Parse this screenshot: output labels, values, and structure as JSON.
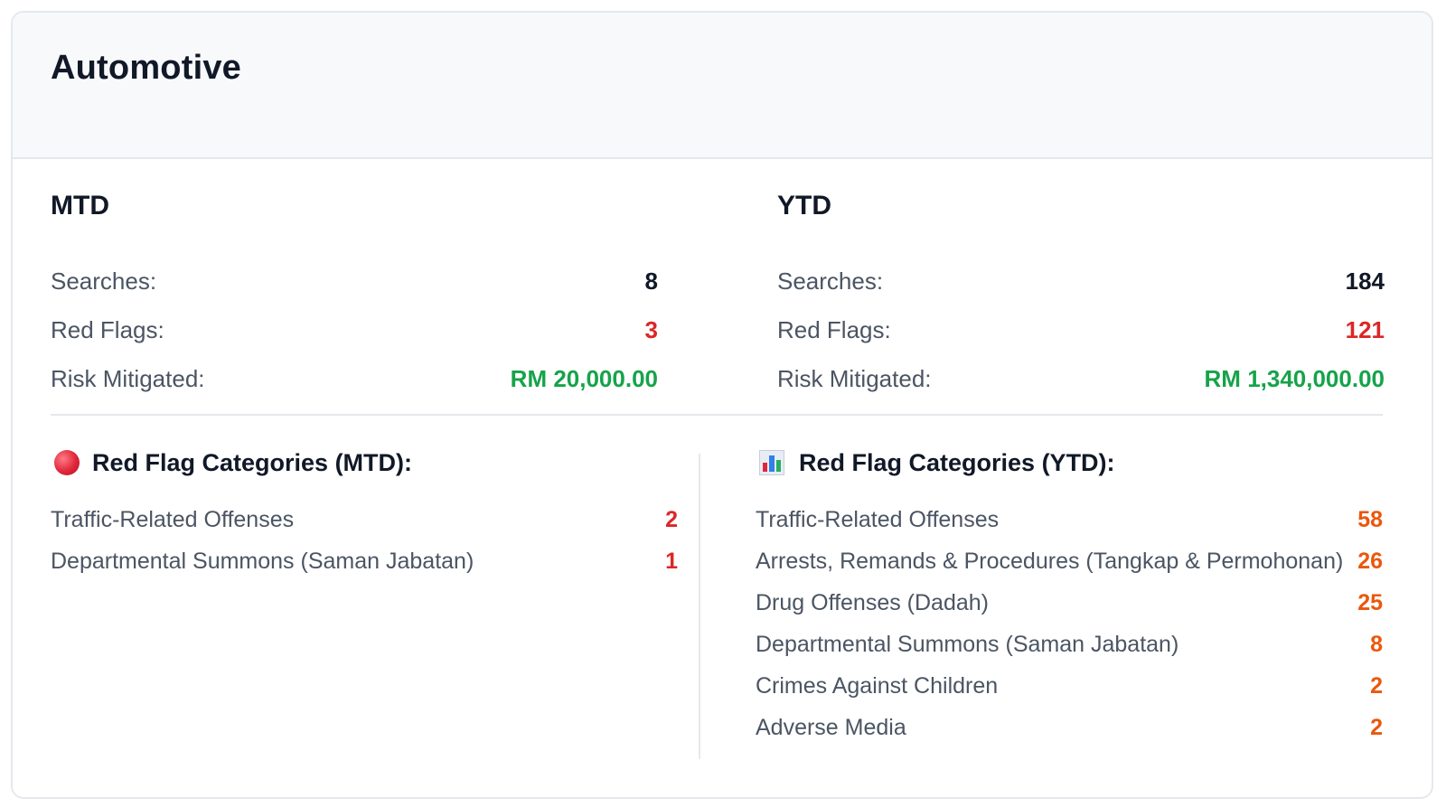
{
  "card": {
    "title": "Automotive"
  },
  "mtd": {
    "title": "MTD",
    "stats": [
      {
        "label": "Searches:",
        "value": "8"
      },
      {
        "label": "Red Flags:",
        "value": "3"
      },
      {
        "label": "Risk Mitigated:",
        "value": "RM 20,000.00"
      }
    ]
  },
  "ytd": {
    "title": "YTD",
    "stats": [
      {
        "label": "Searches:",
        "value": "184"
      },
      {
        "label": "Red Flags:",
        "value": "121"
      },
      {
        "label": "Risk Mitigated:",
        "value": "RM 1,340,000.00"
      }
    ]
  },
  "categories_mtd": {
    "icon": "red-circle-icon",
    "heading": "Red Flag Categories (MTD):",
    "items": [
      {
        "label": "Traffic-Related Offenses",
        "count": "2"
      },
      {
        "label": "Departmental Summons (Saman Jabatan)",
        "count": "1"
      }
    ]
  },
  "categories_ytd": {
    "icon": "bar-chart-icon",
    "heading": "Red Flag Categories (YTD):",
    "items": [
      {
        "label": "Traffic-Related Offenses",
        "count": "58"
      },
      {
        "label": "Arrests, Remands & Procedures (Tangkap & Permohonan)",
        "count": "26"
      },
      {
        "label": "Drug Offenses (Dadah)",
        "count": "25"
      },
      {
        "label": "Departmental Summons (Saman Jabatan)",
        "count": "8"
      },
      {
        "label": "Crimes Against Children",
        "count": "2"
      },
      {
        "label": "Adverse Media",
        "count": "2"
      }
    ]
  },
  "colors": {
    "searches": "#111827",
    "red_flags": "#dc2626",
    "risk_mitigated": "#16a34a",
    "mtd_counts": "#dc2626",
    "ytd_counts": "#ea580c"
  }
}
